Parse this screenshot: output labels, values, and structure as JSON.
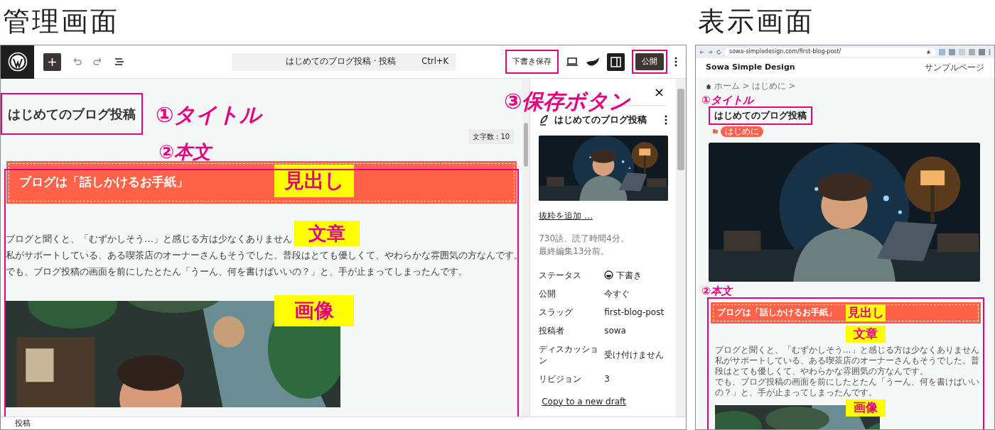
{
  "headings": [
    "管理画面",
    "表示画面"
  ],
  "editor": {
    "toolbar": {
      "command_title": "はじめてのブログ投稿 · 投稿",
      "shortcut": "Ctrl+K",
      "save_draft": "下書き保存",
      "publish": "公開",
      "settings_on": true
    },
    "title": "はじめてのブログ投稿",
    "word_count": "文字数 : 10",
    "blocks": [
      {
        "kind": "heading",
        "text": "ブログは「話しかけるお手紙」",
        "note": "見出し"
      },
      {
        "kind": "paragraph",
        "lines": [
          "ブログと聞くと、「むずかしそう…」と感じる方は少なくありません",
          "私がサポートしている、ある喫茶店のオーナーさんもそうでした。普段はとても優しくて、やわらかな雰囲気の方なんです。",
          "でも、ブログ投稿の画面を前にしたとたん「うーん、何を書けばいいの？」と、手が止まってしまったんです。"
        ],
        "note": "文章"
      },
      {
        "note": "画像"
      }
    ],
    "annotations": {
      "title": "①タイトル",
      "body": "②本文",
      "save": "③保存ボタン"
    },
    "sidebar": {
      "close": "×",
      "post_title": "はじめてのブログ投稿",
      "excerpt_link": "抜粋を追加 …",
      "stats": [
        "730語、読了時間4分。",
        "最終編集13分前。"
      ],
      "fields": [
        {
          "label": "ステータス",
          "value": "下書き",
          "kind": "status"
        },
        {
          "label": "公開",
          "value": "今すぐ",
          "kind": "text"
        },
        {
          "label": "スラッグ",
          "value": "first-blog-post",
          "kind": "text"
        },
        {
          "label": "投稿者",
          "value": "sowa",
          "kind": "text"
        },
        {
          "label": "ディスカッション",
          "value": "受け付けません",
          "kind": "text"
        },
        {
          "label": "リビジョン",
          "value": "3",
          "kind": "text"
        }
      ],
      "copy_link": "Copy to a new draft"
    },
    "status_bar": "投稿"
  },
  "preview": {
    "url": "sowa-simpledesign.com/first-blog-post/",
    "site_title": "Sowa Simple Design",
    "nav": [
      "サンプルページ"
    ],
    "breadcrumb": "ホーム > はじめに >",
    "title": "はじめてのブログ投稿",
    "category": "はじめに",
    "annotations": {
      "title": "①タイトル",
      "body": "②本文"
    },
    "blocks": [
      {
        "kind": "heading",
        "text": "ブログは「話しかけるお手紙」",
        "note": "見出し"
      },
      {
        "kind": "paragraph",
        "lines": [
          "ブログと聞くと、「むずかしそう…」と感じる方は少なくありません",
          "私がサポートしている、ある喫茶店のオーナーさんもそうでした。普段はとても優しくて、やわらかな雰囲気の方なんです。",
          "でも、ブログ投稿の画面を前にしたとたん「うーん、何を書けばいいの？」と、手が止まってしまったんです。"
        ],
        "note": "文章"
      },
      {
        "note": "画像"
      }
    ]
  }
}
